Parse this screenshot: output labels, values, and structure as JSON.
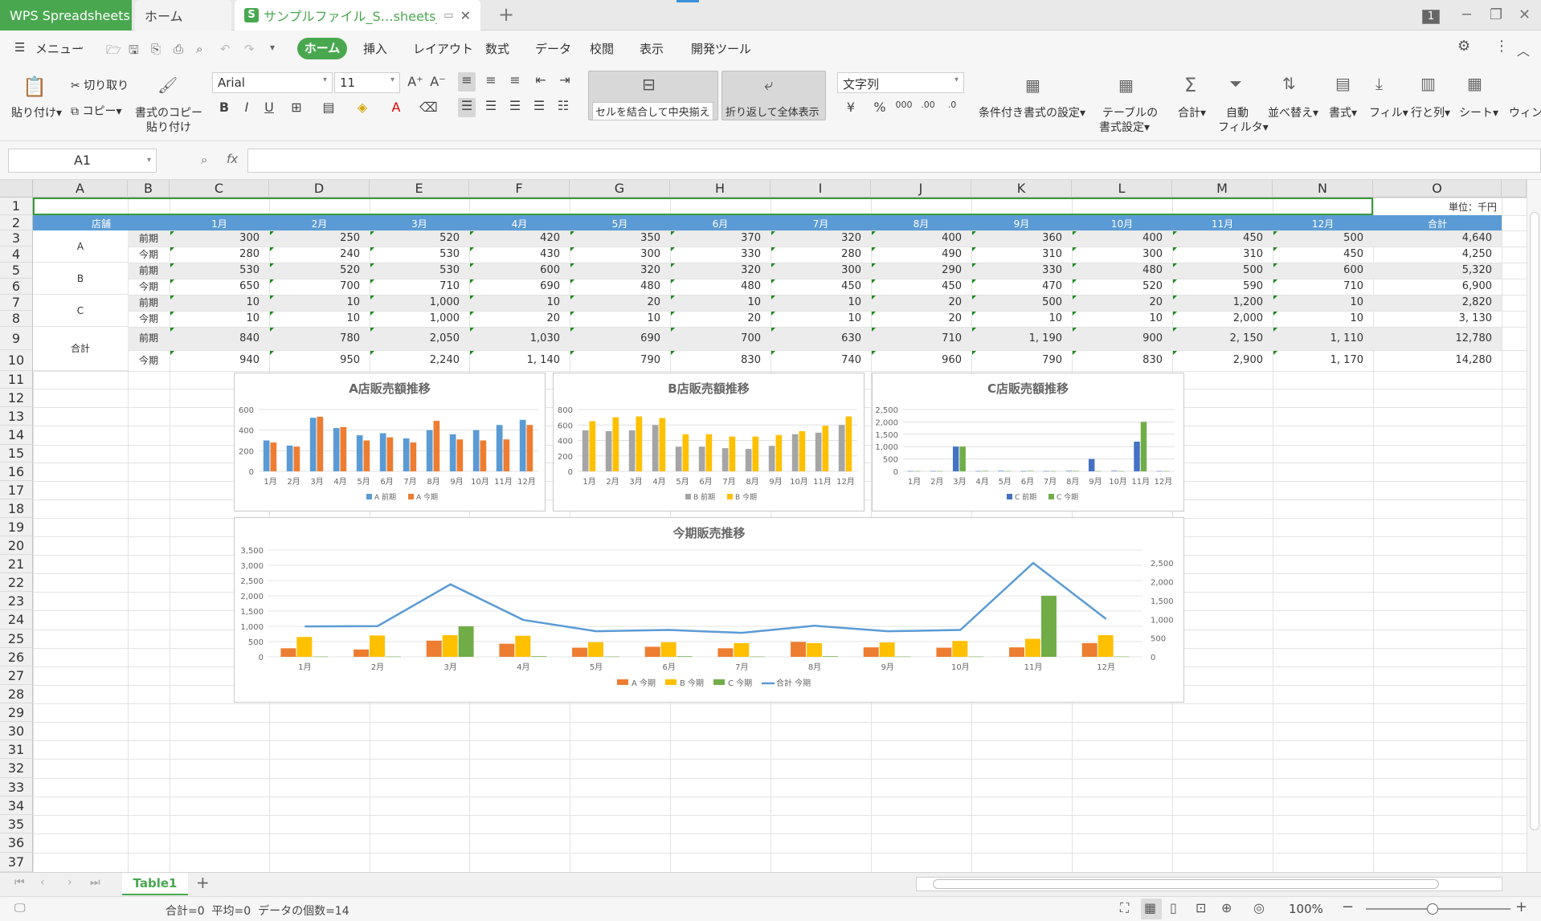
{
  "titlebar": {
    "app_tab": "WPS Spreadsheets",
    "home_tab": "ホーム",
    "file_tab": "サンプルファイル_S…sheets_Mac",
    "file_icon_letter": "S",
    "window_count": "1"
  },
  "menubar": {
    "menu_label": "メニュー",
    "tabs": [
      "ホーム",
      "挿入",
      "レイアウト",
      "数式",
      "データ",
      "校閲",
      "表示",
      "開発ツール"
    ]
  },
  "ribbon": {
    "paste": "貼り付け",
    "cut": "切り取り",
    "copy": "コピー",
    "format_copy_1": "書式のコピー",
    "format_copy_2": "貼り付け",
    "font_name": "Arial",
    "font_size": "11",
    "merge_center": "セルを結合して中央揃え",
    "wrap_text": "折り返して全体表示",
    "number_format": "文字列",
    "cond_format": "条件付き書式の設定",
    "table_format_1": "テーブルの",
    "table_format_2": "書式設定",
    "sum": "合計",
    "auto_filter_1": "自動",
    "auto_filter_2": "フィルタ",
    "sort": "並べ替え",
    "format": "書式",
    "fill": "フィル",
    "rows_cols": "行と列",
    "sheet": "シート",
    "window": "ウィン"
  },
  "formula_bar": {
    "name_box": "A1",
    "fx": "fx",
    "formula": ""
  },
  "grid": {
    "columns": [
      "A",
      "B",
      "C",
      "D",
      "E",
      "F",
      "G",
      "H",
      "I",
      "J",
      "K",
      "L",
      "M",
      "N",
      "O"
    ],
    "rows": [
      "1",
      "2",
      "3",
      "4",
      "5",
      "6",
      "7",
      "8",
      "9",
      "10",
      "11",
      "12",
      "13",
      "14",
      "15",
      "16",
      "17",
      "18",
      "19",
      "20",
      "21",
      "22",
      "23",
      "24",
      "25",
      "26",
      "27",
      "28",
      "29",
      "30",
      "31",
      "32",
      "33",
      "34",
      "35",
      "36",
      "37"
    ],
    "unit_label": "単位：千円",
    "header": {
      "store": "店舗",
      "months": [
        "1月",
        "2月",
        "3月",
        "4月",
        "5月",
        "6月",
        "7月",
        "8月",
        "9月",
        "10月",
        "11月",
        "12月"
      ],
      "total": "合計"
    },
    "stores": [
      "A",
      "B",
      "C",
      "合計"
    ],
    "period_labels": [
      "前期",
      "今期",
      "前期",
      "今期",
      "前期",
      "今期",
      "前期",
      "今期"
    ],
    "data_rows": [
      [
        "300",
        "250",
        "520",
        "420",
        "350",
        "370",
        "320",
        "400",
        "360",
        "400",
        "450",
        "500",
        "4,640"
      ],
      [
        "280",
        "240",
        "530",
        "430",
        "300",
        "330",
        "280",
        "490",
        "310",
        "300",
        "310",
        "450",
        "4,250"
      ],
      [
        "530",
        "520",
        "530",
        "600",
        "320",
        "320",
        "300",
        "290",
        "330",
        "480",
        "500",
        "600",
        "5,320"
      ],
      [
        "650",
        "700",
        "710",
        "690",
        "480",
        "480",
        "450",
        "450",
        "470",
        "520",
        "590",
        "710",
        "6,900"
      ],
      [
        "10",
        "10",
        "1,000",
        "10",
        "20",
        "10",
        "10",
        "20",
        "500",
        "20",
        "1,200",
        "10",
        "2,820"
      ],
      [
        "10",
        "10",
        "1,000",
        "20",
        "10",
        "20",
        "10",
        "20",
        "10",
        "10",
        "2,000",
        "10",
        "3, 130"
      ],
      [
        "840",
        "780",
        "2,050",
        "1,030",
        "690",
        "700",
        "630",
        "710",
        "1, 190",
        "900",
        "2, 150",
        "1, 110",
        "12,780"
      ],
      [
        "940",
        "950",
        "2,240",
        "1, 140",
        "790",
        "830",
        "740",
        "960",
        "790",
        "830",
        "2,900",
        "1, 170",
        "14,280"
      ]
    ]
  },
  "chart_data": [
    {
      "type": "bar",
      "title": "A店販売額推移",
      "categories": [
        "1月",
        "2月",
        "3月",
        "4月",
        "5月",
        "6月",
        "7月",
        "8月",
        "9月",
        "10月",
        "11月",
        "12月"
      ],
      "series": [
        {
          "name": "A 前期",
          "values": [
            300,
            250,
            520,
            420,
            350,
            370,
            320,
            400,
            360,
            400,
            450,
            500
          ],
          "color": "#5b9bd5"
        },
        {
          "name": "A 今期",
          "values": [
            280,
            240,
            530,
            430,
            300,
            330,
            280,
            490,
            310,
            300,
            310,
            450
          ],
          "color": "#ed7d31"
        }
      ],
      "ylim": [
        0,
        600
      ],
      "yticks": [
        "0",
        "200",
        "400",
        "600"
      ]
    },
    {
      "type": "bar",
      "title": "B店販売額推移",
      "categories": [
        "1月",
        "2月",
        "3月",
        "4月",
        "5月",
        "6月",
        "7月",
        "8月",
        "9月",
        "10月",
        "11月",
        "12月"
      ],
      "series": [
        {
          "name": "B 前期",
          "values": [
            530,
            520,
            530,
            600,
            320,
            320,
            300,
            290,
            330,
            480,
            500,
            600
          ],
          "color": "#a5a5a5"
        },
        {
          "name": "B 今期",
          "values": [
            650,
            700,
            710,
            690,
            480,
            480,
            450,
            450,
            470,
            520,
            590,
            710
          ],
          "color": "#ffc000"
        }
      ],
      "ylim": [
        0,
        800
      ],
      "yticks": [
        "0",
        "200",
        "400",
        "600",
        "800"
      ]
    },
    {
      "type": "bar",
      "title": "C店販売額推移",
      "categories": [
        "1月",
        "2月",
        "3月",
        "4月",
        "5月",
        "6月",
        "7月",
        "8月",
        "9月",
        "10月",
        "11月",
        "12月"
      ],
      "series": [
        {
          "name": "C 前期",
          "values": [
            10,
            10,
            1000,
            10,
            20,
            10,
            10,
            20,
            500,
            20,
            1200,
            10
          ],
          "color": "#4472c4"
        },
        {
          "name": "C 今期",
          "values": [
            10,
            10,
            1000,
            20,
            10,
            20,
            10,
            20,
            10,
            10,
            2000,
            10
          ],
          "color": "#70ad47"
        }
      ],
      "ylim": [
        0,
        2500
      ],
      "yticks": [
        "0",
        "500",
        "1,000",
        "1,500",
        "2,000",
        "2,500"
      ]
    },
    {
      "type": "bar",
      "title": "今期販売推移",
      "categories": [
        "1月",
        "2月",
        "3月",
        "4月",
        "5月",
        "6月",
        "7月",
        "8月",
        "9月",
        "10月",
        "11月",
        "12月"
      ],
      "series": [
        {
          "name": "A 今期",
          "values": [
            280,
            240,
            530,
            430,
            300,
            330,
            280,
            490,
            310,
            300,
            310,
            450
          ],
          "color": "#ed7d31",
          "kind": "bar"
        },
        {
          "name": "B 今期",
          "values": [
            650,
            700,
            710,
            690,
            480,
            480,
            450,
            450,
            470,
            520,
            590,
            710
          ],
          "color": "#ffc000",
          "kind": "bar"
        },
        {
          "name": "C 今期",
          "values": [
            10,
            10,
            1000,
            20,
            10,
            20,
            10,
            20,
            10,
            10,
            2000,
            10
          ],
          "color": "#70ad47",
          "kind": "bar"
        },
        {
          "name": "合計 今期",
          "values": [
            940,
            950,
            2240,
            1140,
            790,
            830,
            740,
            960,
            790,
            830,
            2900,
            1170
          ],
          "color": "#5b9bd5",
          "kind": "line"
        }
      ],
      "ylim": [
        0,
        3500
      ],
      "yticks": [
        "0",
        "500",
        "1,000",
        "1,500",
        "2,000",
        "2,500",
        "3,000",
        "3,500"
      ],
      "y2ticks": [
        "0",
        "500",
        "1,000",
        "1,500",
        "2,000",
        "2,500"
      ]
    }
  ],
  "sheet_tabs": [
    "Table1"
  ],
  "status": {
    "summary": "合計=0  平均=0  データの個数=14",
    "zoom": "100%"
  }
}
